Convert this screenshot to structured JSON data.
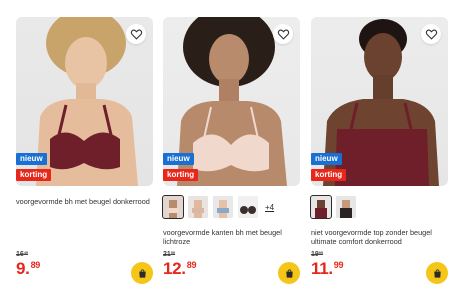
{
  "colors": {
    "badge_new": "#1a6fd4",
    "badge_sale": "#e8271b",
    "price": "#e8271b",
    "cart_button": "#f5c517"
  },
  "products": [
    {
      "badges": [
        "nieuw",
        "korting"
      ],
      "title": "voorgevormde bh met beugel donkerrood",
      "old_price": {
        "main": "16",
        "cents": "49"
      },
      "price": {
        "main": "9.",
        "cents": "89"
      },
      "icons": {
        "favorite": "heart-icon",
        "cart": "shopping-bag-icon"
      }
    },
    {
      "badges": [
        "nieuw",
        "korting"
      ],
      "swatches_more": "+4",
      "title": "voorgevormde kanten bh met beugel lichtroze",
      "old_price": {
        "main": "21",
        "cents": "99"
      },
      "price": {
        "main": "12.",
        "cents": "89"
      },
      "icons": {
        "favorite": "heart-icon",
        "cart": "shopping-bag-icon"
      }
    },
    {
      "badges": [
        "nieuw",
        "korting"
      ],
      "title": "niet voorgevormde top zonder beugel ultimate comfort donkerrood",
      "old_price": {
        "main": "19",
        "cents": "99"
      },
      "price": {
        "main": "11.",
        "cents": "99"
      },
      "icons": {
        "favorite": "heart-icon",
        "cart": "shopping-bag-icon"
      }
    }
  ]
}
